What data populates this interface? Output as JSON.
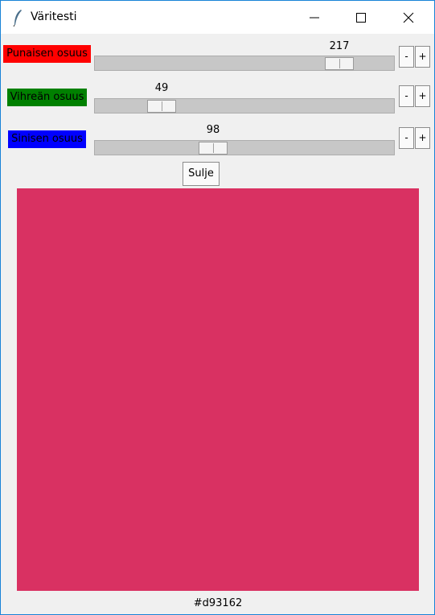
{
  "window": {
    "title": "Väritesti"
  },
  "colors": {
    "red_label_bg": "#ff0000",
    "green_label_bg": "#008000",
    "blue_label_bg": "#0000ff",
    "swatch": "#d93162"
  },
  "sliders": [
    {
      "label": "Punaisen osuus",
      "value": "217",
      "max": 255,
      "minus": "-",
      "plus": "+"
    },
    {
      "label": "Vihreän osuus",
      "value": "49",
      "max": 255,
      "minus": "-",
      "plus": "+"
    },
    {
      "label": "Sinisen osuus",
      "value": "98",
      "max": 255,
      "minus": "-",
      "plus": "+"
    }
  ],
  "close_button": "Sulje",
  "hex_value": "#d93162",
  "icons": {
    "app": "feather-icon",
    "minimize": "minimize-icon",
    "maximize": "maximize-icon",
    "close": "close-icon"
  }
}
